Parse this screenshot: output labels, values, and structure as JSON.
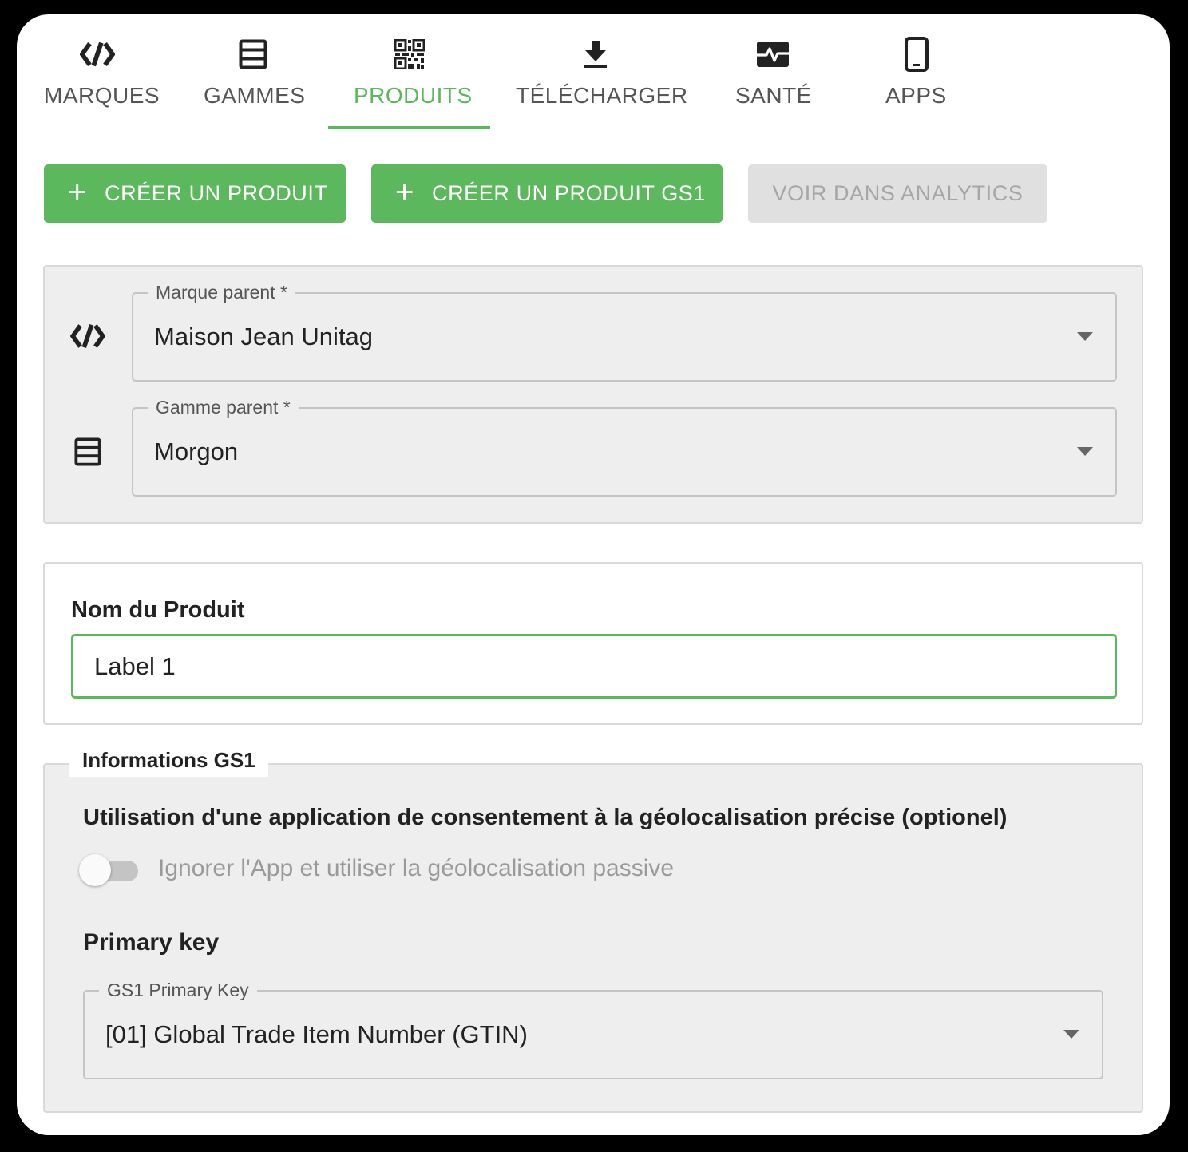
{
  "tabs": [
    {
      "label": "MARQUES",
      "icon": "brand-code-icon"
    },
    {
      "label": "GAMMES",
      "icon": "list-box-icon"
    },
    {
      "label": "PRODUITS",
      "icon": "qr-code-icon",
      "active": true
    },
    {
      "label": "TÉLÉCHARGER",
      "icon": "download-icon"
    },
    {
      "label": "SANTÉ",
      "icon": "health-pulse-icon"
    },
    {
      "label": "APPS",
      "icon": "smartphone-icon"
    }
  ],
  "actions": {
    "create_product": "CRÉER UN PRODUIT",
    "create_product_gs1": "CRÉER UN PRODUIT GS1",
    "view_analytics": "VOIR DANS ANALYTICS"
  },
  "parent": {
    "brand": {
      "legend": "Marque parent *",
      "value": "Maison Jean Unitag"
    },
    "range": {
      "legend": "Gamme parent *",
      "value": "Morgon"
    }
  },
  "product_name": {
    "label": "Nom du Produit",
    "value": "Label 1"
  },
  "gs1": {
    "tab_label": "Informations GS1",
    "geoloc_heading": "Utilisation d'une application de consentement à la géolocalisation précise (optionel)",
    "toggle_label": "Ignorer l'App et utiliser la géolocalisation passive",
    "toggle_on": false,
    "primary_key_heading": "Primary key",
    "primary_key_legend": "GS1 Primary Key",
    "primary_key_value": "[01] Global Trade Item Number (GTIN)"
  },
  "colors": {
    "accent": "#5cb85c",
    "panel_grey": "#eeeeee",
    "disabled_bg": "#e0e0e0"
  }
}
